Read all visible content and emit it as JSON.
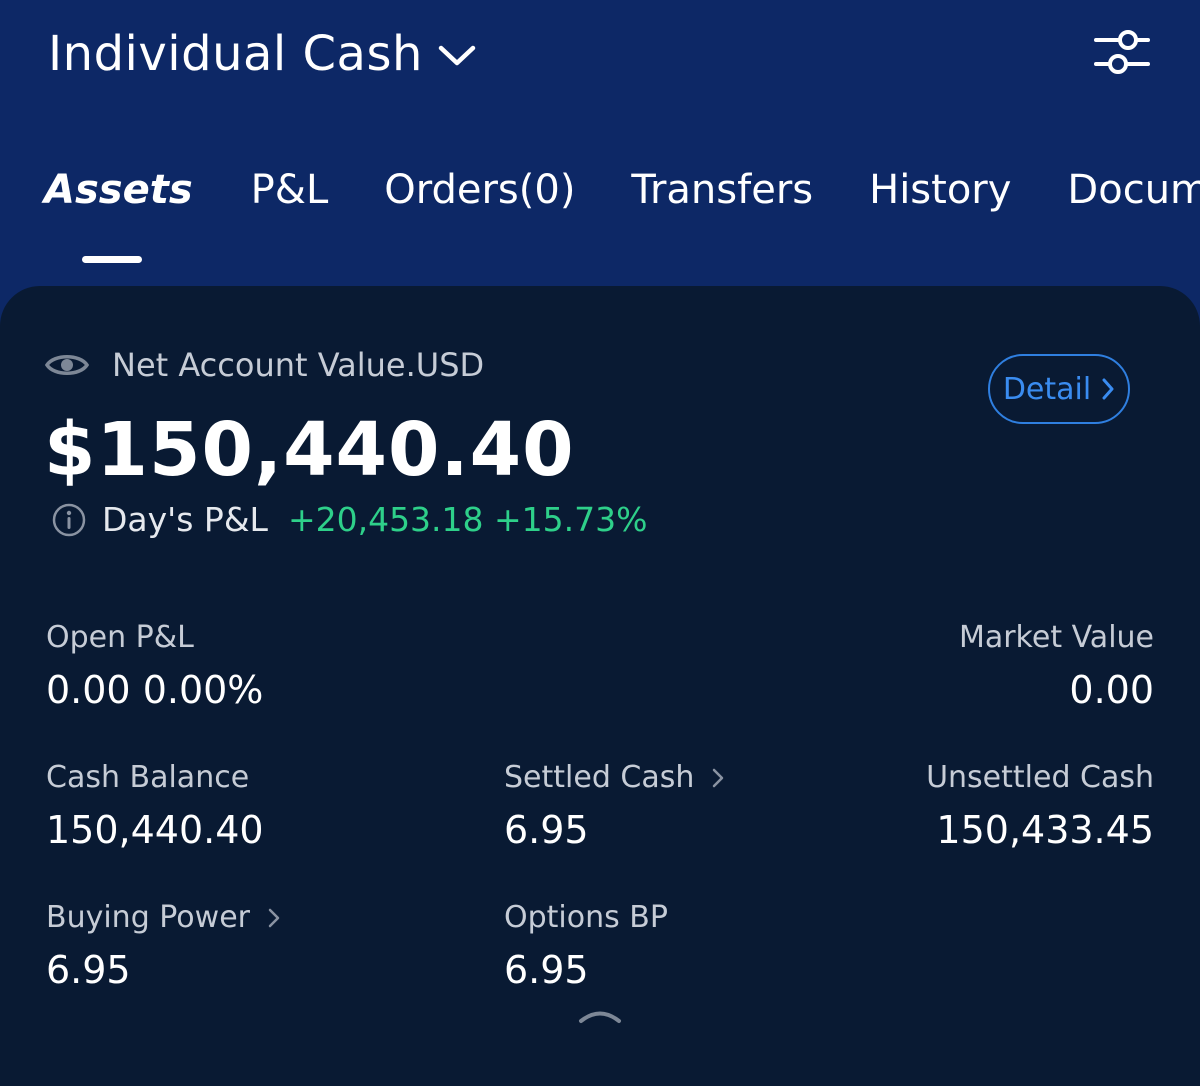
{
  "header": {
    "account_name": "Individual Cash",
    "tabs": [
      {
        "label": "Assets",
        "active": true
      },
      {
        "label": "P&L",
        "active": false
      },
      {
        "label": "Orders(0)",
        "active": false
      },
      {
        "label": "Transfers",
        "active": false
      },
      {
        "label": "History",
        "active": false
      },
      {
        "label": "Docume",
        "active": false
      }
    ]
  },
  "summary": {
    "net_label": "Net Account Value.USD",
    "net_value": "$150,440.40",
    "detail_label": "Detail",
    "day_pl_label": "Day's P&L",
    "day_pl_value": "+20,453.18 +15.73%"
  },
  "metrics": {
    "open_pl": {
      "label": "Open P&L",
      "value": "0.00 0.00%"
    },
    "market_value": {
      "label": "Market Value",
      "value": "0.00"
    },
    "cash_balance": {
      "label": "Cash Balance",
      "value": "150,440.40"
    },
    "settled_cash": {
      "label": "Settled Cash",
      "value": "6.95"
    },
    "unsettled_cash": {
      "label": "Unsettled Cash",
      "value": "150,433.45"
    },
    "buying_power": {
      "label": "Buying Power",
      "value": "6.95"
    },
    "options_bp": {
      "label": "Options BP",
      "value": "6.95"
    }
  },
  "colors": {
    "header_bg": "#0d2866",
    "card_bg": "#091a33",
    "positive": "#2ed08a",
    "accent": "#2f7fe0"
  },
  "icons": [
    "chevron-down-icon",
    "filter-sliders-icon",
    "eye-icon",
    "info-icon",
    "chevron-right-icon",
    "collapse-arrow-icon"
  ]
}
